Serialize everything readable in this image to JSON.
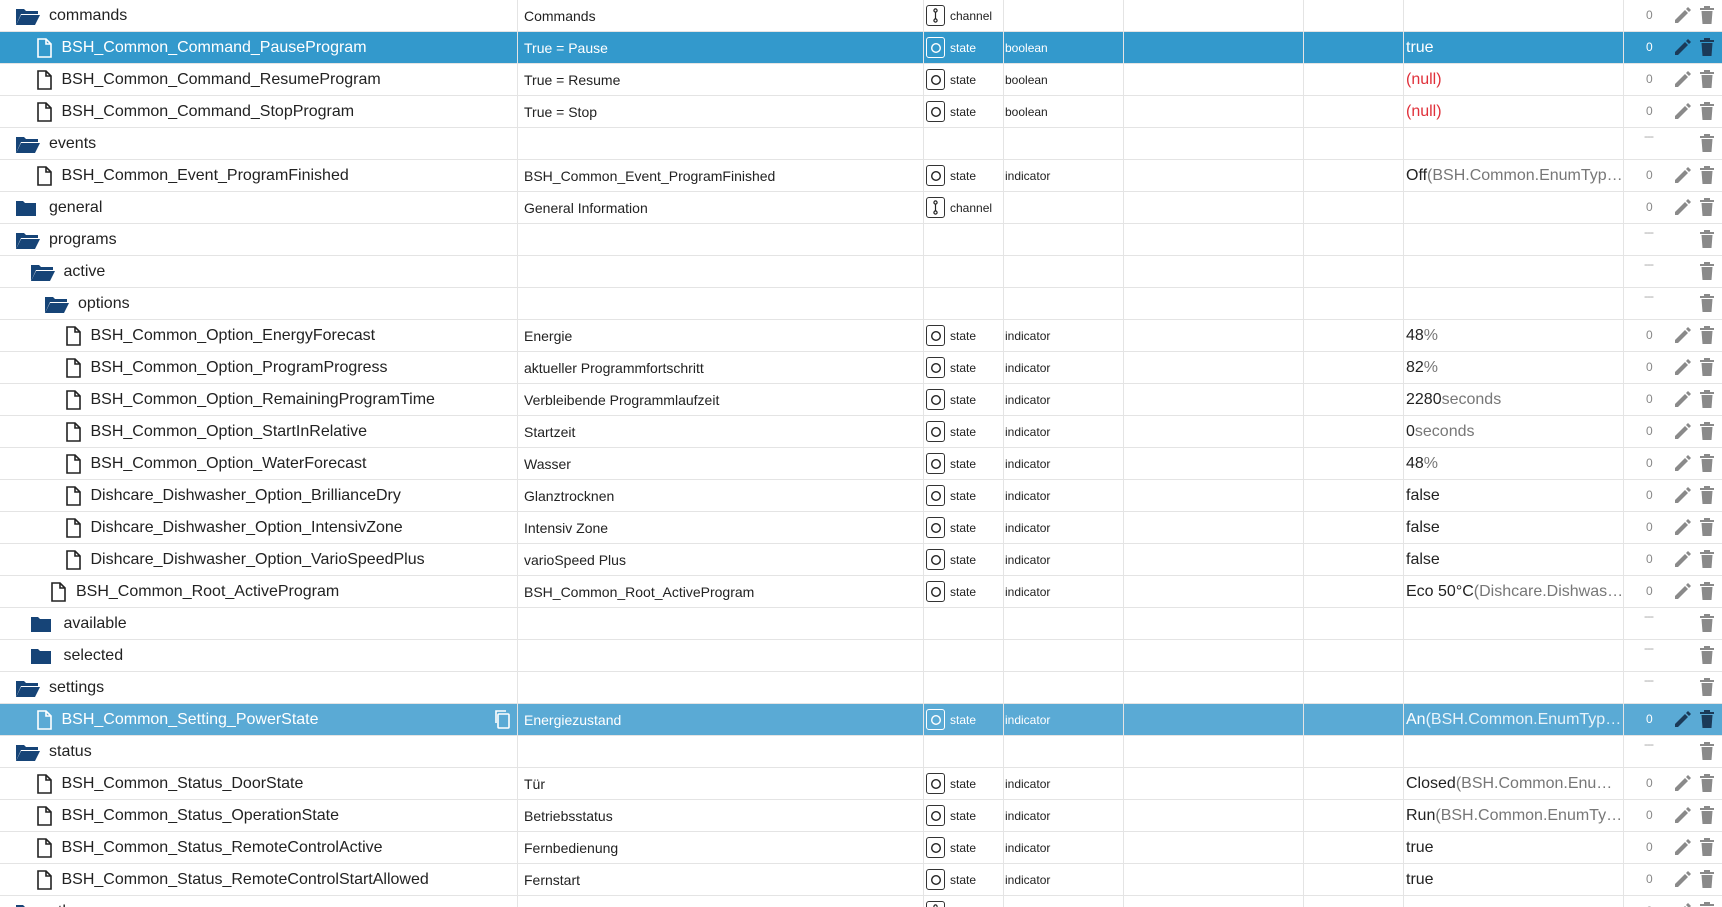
{
  "colors": {
    "folder": "#164477",
    "selected_row": "#3399cc",
    "hover_row": "#5aaad5",
    "null_text": "#e0303a"
  },
  "rows": [
    {
      "kind": "folder-open",
      "depth": 0,
      "name": "commands",
      "desc": "Commands",
      "type": "channel",
      "role": "",
      "value": "",
      "unit": "",
      "enum": "",
      "ack": "0",
      "dash": false,
      "sel": ""
    },
    {
      "kind": "state",
      "depth": 1,
      "name": "BSH_Common_Command_PauseProgram",
      "desc": "True = Pause",
      "type": "state",
      "role": "boolean",
      "value": "true",
      "unit": "",
      "enum": "",
      "ack": "0",
      "dash": false,
      "sel": "sel1"
    },
    {
      "kind": "state",
      "depth": 1,
      "name": "BSH_Common_Command_ResumeProgram",
      "desc": "True = Resume",
      "type": "state",
      "role": "boolean",
      "value": "(null)",
      "unit": "",
      "enum": "",
      "ack": "0",
      "dash": false,
      "sel": "",
      "null": true
    },
    {
      "kind": "state",
      "depth": 1,
      "name": "BSH_Common_Command_StopProgram",
      "desc": "True = Stop",
      "type": "state",
      "role": "boolean",
      "value": "(null)",
      "unit": "",
      "enum": "",
      "ack": "0",
      "dash": false,
      "sel": "",
      "null": true
    },
    {
      "kind": "folder-open",
      "depth": 0,
      "name": "events",
      "desc": "",
      "type": "",
      "role": "",
      "value": "",
      "unit": "",
      "enum": "",
      "ack": "---",
      "dash": true,
      "sel": ""
    },
    {
      "kind": "state",
      "depth": 1,
      "name": "BSH_Common_Event_ProgramFinished",
      "desc": "BSH_Common_Event_ProgramFinished",
      "type": "state",
      "role": "indicator",
      "value": "Off",
      "unit": "",
      "enum": "(BSH.Common.EnumTyp…",
      "ack": "0",
      "dash": false,
      "sel": ""
    },
    {
      "kind": "folder",
      "depth": 0,
      "name": "general",
      "desc": "General Information",
      "type": "channel",
      "role": "",
      "value": "",
      "unit": "",
      "enum": "",
      "ack": "0",
      "dash": false,
      "sel": ""
    },
    {
      "kind": "folder-open",
      "depth": 0,
      "name": "programs",
      "desc": "",
      "type": "",
      "role": "",
      "value": "",
      "unit": "",
      "enum": "",
      "ack": "---",
      "dash": true,
      "sel": ""
    },
    {
      "kind": "folder-open",
      "depth": 1,
      "name": "active",
      "desc": "",
      "type": "",
      "role": "",
      "value": "",
      "unit": "",
      "enum": "",
      "ack": "---",
      "dash": true,
      "sel": ""
    },
    {
      "kind": "folder-open",
      "depth": 2,
      "name": "options",
      "desc": "",
      "type": "",
      "role": "",
      "value": "",
      "unit": "",
      "enum": "",
      "ack": "---",
      "dash": true,
      "sel": ""
    },
    {
      "kind": "state",
      "depth": 3,
      "name": "BSH_Common_Option_EnergyForecast",
      "desc": "Energie",
      "type": "state",
      "role": "indicator",
      "value": "48",
      "unit": " %",
      "enum": "",
      "ack": "0",
      "dash": false,
      "sel": ""
    },
    {
      "kind": "state",
      "depth": 3,
      "name": "BSH_Common_Option_ProgramProgress",
      "desc": "aktueller Programmfortschritt",
      "type": "state",
      "role": "indicator",
      "value": "82",
      "unit": " %",
      "enum": "",
      "ack": "0",
      "dash": false,
      "sel": ""
    },
    {
      "kind": "state",
      "depth": 3,
      "name": "BSH_Common_Option_RemainingProgramTime",
      "desc": "Verbleibende Programmlaufzeit",
      "type": "state",
      "role": "indicator",
      "value": "2280",
      "unit": " seconds",
      "enum": "",
      "ack": "0",
      "dash": false,
      "sel": ""
    },
    {
      "kind": "state",
      "depth": 3,
      "name": "BSH_Common_Option_StartInRelative",
      "desc": "Startzeit",
      "type": "state",
      "role": "indicator",
      "value": "0",
      "unit": " seconds",
      "enum": "",
      "ack": "0",
      "dash": false,
      "sel": ""
    },
    {
      "kind": "state",
      "depth": 3,
      "name": "BSH_Common_Option_WaterForecast",
      "desc": "Wasser",
      "type": "state",
      "role": "indicator",
      "value": "48",
      "unit": " %",
      "enum": "",
      "ack": "0",
      "dash": false,
      "sel": ""
    },
    {
      "kind": "state",
      "depth": 3,
      "name": "Dishcare_Dishwasher_Option_BrillianceDry",
      "desc": "Glanztrocknen",
      "type": "state",
      "role": "indicator",
      "value": "false",
      "unit": "",
      "enum": "",
      "ack": "0",
      "dash": false,
      "sel": ""
    },
    {
      "kind": "state",
      "depth": 3,
      "name": "Dishcare_Dishwasher_Option_IntensivZone",
      "desc": "Intensiv Zone",
      "type": "state",
      "role": "indicator",
      "value": "false",
      "unit": "",
      "enum": "",
      "ack": "0",
      "dash": false,
      "sel": ""
    },
    {
      "kind": "state",
      "depth": 3,
      "name": "Dishcare_Dishwasher_Option_VarioSpeedPlus",
      "desc": "varioSpeed Plus",
      "type": "state",
      "role": "indicator",
      "value": "false",
      "unit": "",
      "enum": "",
      "ack": "0",
      "dash": false,
      "sel": ""
    },
    {
      "kind": "state",
      "depth": 2,
      "name": "BSH_Common_Root_ActiveProgram",
      "desc": "BSH_Common_Root_ActiveProgram",
      "type": "state",
      "role": "indicator",
      "value": "Eco 50°C",
      "unit": "",
      "enum": "(Dishcare.Dishwas…",
      "ack": "0",
      "dash": false,
      "sel": ""
    },
    {
      "kind": "folder",
      "depth": 1,
      "name": "available",
      "desc": "",
      "type": "",
      "role": "",
      "value": "",
      "unit": "",
      "enum": "",
      "ack": "---",
      "dash": true,
      "sel": ""
    },
    {
      "kind": "folder",
      "depth": 1,
      "name": "selected",
      "desc": "",
      "type": "",
      "role": "",
      "value": "",
      "unit": "",
      "enum": "",
      "ack": "---",
      "dash": true,
      "sel": ""
    },
    {
      "kind": "folder-open",
      "depth": 0,
      "name": "settings",
      "desc": "",
      "type": "",
      "role": "",
      "value": "",
      "unit": "",
      "enum": "",
      "ack": "---",
      "dash": true,
      "sel": ""
    },
    {
      "kind": "state",
      "depth": 1,
      "name": "BSH_Common_Setting_PowerState",
      "desc": "Energiezustand",
      "type": "state",
      "role": "indicator",
      "value": "An",
      "unit": "",
      "enum": "(BSH.Common.EnumTyp…",
      "ack": "0",
      "dash": false,
      "sel": "sel2",
      "copy": true
    },
    {
      "kind": "folder-open",
      "depth": 0,
      "name": "status",
      "desc": "",
      "type": "",
      "role": "",
      "value": "",
      "unit": "",
      "enum": "",
      "ack": "---",
      "dash": true,
      "sel": ""
    },
    {
      "kind": "state",
      "depth": 1,
      "name": "BSH_Common_Status_DoorState",
      "desc": "Tür",
      "type": "state",
      "role": "indicator",
      "value": "Closed",
      "unit": "",
      "enum": "(BSH.Common.Enu…",
      "ack": "0",
      "dash": false,
      "sel": ""
    },
    {
      "kind": "state",
      "depth": 1,
      "name": "BSH_Common_Status_OperationState",
      "desc": "Betriebsstatus",
      "type": "state",
      "role": "indicator",
      "value": "Run",
      "unit": "",
      "enum": "(BSH.Common.EnumTy…",
      "ack": "0",
      "dash": false,
      "sel": ""
    },
    {
      "kind": "state",
      "depth": 1,
      "name": "BSH_Common_Status_RemoteControlActive",
      "desc": "Fernbedienung",
      "type": "state",
      "role": "indicator",
      "value": "true",
      "unit": "",
      "enum": "",
      "ack": "0",
      "dash": false,
      "sel": ""
    },
    {
      "kind": "state",
      "depth": 1,
      "name": "BSH_Common_Status_RemoteControlStartAllowed",
      "desc": "Fernstart",
      "type": "state",
      "role": "indicator",
      "value": "true",
      "unit": "",
      "enum": "",
      "ack": "0",
      "dash": false,
      "sel": ""
    },
    {
      "kind": "folder",
      "depth": 0,
      "name": "other",
      "desc": "Andere Informationen",
      "type": "channel",
      "role": "",
      "value": "",
      "unit": "",
      "enum": "",
      "ack": "0",
      "dash": false,
      "sel": ""
    }
  ]
}
